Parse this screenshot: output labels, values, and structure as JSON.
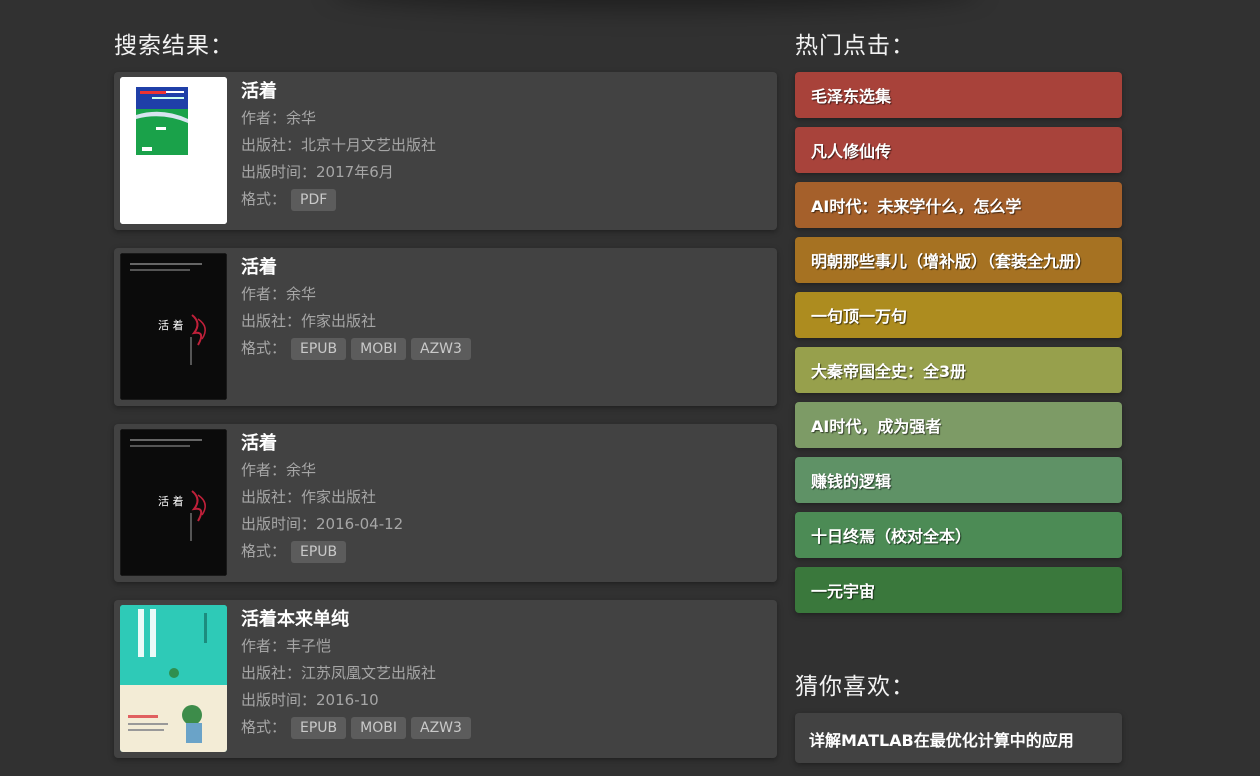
{
  "results_title": "搜索结果：",
  "hot_title": "热门点击：",
  "guess_title": "猜你喜欢：",
  "labels": {
    "author": "作者：",
    "publisher": "出版社：",
    "pub_date": "出版时间：",
    "format": "格式："
  },
  "results": [
    {
      "title": "活着",
      "author": "余华",
      "publisher": "北京十月文艺出版社",
      "pub_date": "2017年6月",
      "formats": [
        "PDF"
      ]
    },
    {
      "title": "活着",
      "author": "余华",
      "publisher": "作家出版社",
      "pub_date": "",
      "formats": [
        "EPUB",
        "MOBI",
        "AZW3"
      ]
    },
    {
      "title": "活着",
      "author": "余华",
      "publisher": "作家出版社",
      "pub_date": "2016-04-12",
      "formats": [
        "EPUB"
      ]
    },
    {
      "title": "活着本来单纯",
      "author": "丰子恺",
      "publisher": "江苏凤凰文艺出版社",
      "pub_date": "2016-10",
      "formats": [
        "EPUB",
        "MOBI",
        "AZW3"
      ]
    }
  ],
  "hot_items": [
    {
      "label": "毛泽东选集",
      "color": "#a8423a"
    },
    {
      "label": "凡人修仙传",
      "color": "#a8433b"
    },
    {
      "label": "AI时代：未来学什么，怎么学",
      "color": "#a5602b"
    },
    {
      "label": "明朝那些事儿（增补版）（套装全九册）",
      "color": "#a67222"
    },
    {
      "label": "一句顶一万句",
      "color": "#ad8c1f"
    },
    {
      "label": "大秦帝国全史：全3册",
      "color": "#97a04c"
    },
    {
      "label": "AI时代，成为强者",
      "color": "#7d9b66"
    },
    {
      "label": "赚钱的逻辑",
      "color": "#5f9266"
    },
    {
      "label": "十日终焉（校对全本）",
      "color": "#4c8b55"
    },
    {
      "label": "一元宇宙",
      "color": "#3a783c"
    }
  ],
  "guess_items": [
    {
      "label": "详解MATLAB在最优化计算中的应用"
    }
  ],
  "cover_texts": {
    "book1_title": "活着",
    "book2_title": "活 着",
    "book4_title": "活着本来单纯"
  }
}
